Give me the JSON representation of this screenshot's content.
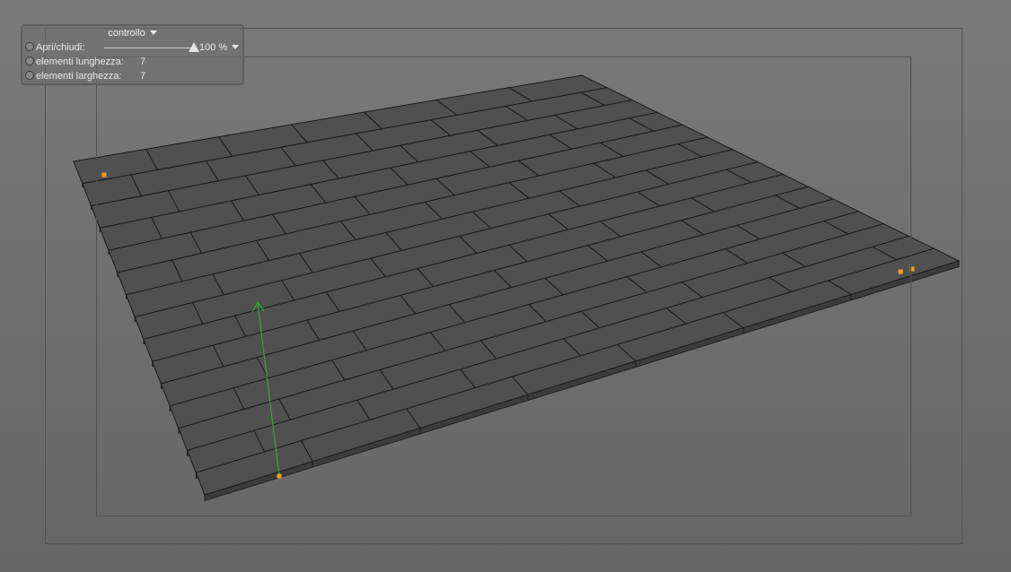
{
  "hud": {
    "title": "controllo",
    "rows": [
      {
        "label": "Apri/chiudi:",
        "value": "100 %",
        "slider_level": 1.0
      },
      {
        "label": "elementi lunghezza:",
        "value": "7"
      },
      {
        "label": "elementi larghezza:",
        "value": "7"
      }
    ]
  },
  "scene": {
    "tile_columns": 7,
    "tile_rows": 15,
    "colors": {
      "tile_top": "#505050",
      "tile_side": "#3c3c3c",
      "tile_edge": "#1a1a1a",
      "handle": "#f0a020",
      "axis": "#2faa2f"
    }
  }
}
